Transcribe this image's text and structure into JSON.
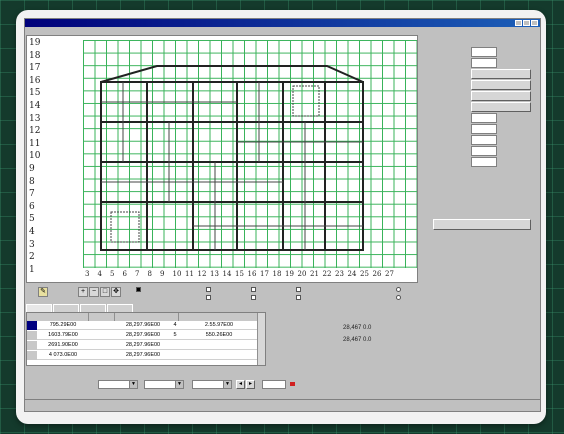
{
  "window": {
    "title": "",
    "menu": [
      "",
      "",
      "",
      "",
      ""
    ]
  },
  "canvas": {
    "row_labels": [
      "19",
      "18",
      "17",
      "16",
      "15",
      "14",
      "13",
      "12",
      "11",
      "10",
      "9",
      "8",
      "7",
      "6",
      "5",
      "4",
      "3",
      "2",
      "1"
    ],
    "col_labels": [
      "3",
      "4",
      "5",
      "6",
      "7",
      "8",
      "9",
      "10",
      "11",
      "12",
      "13",
      "14",
      "15",
      "16",
      "17",
      "18",
      "19",
      "20",
      "21",
      "22",
      "23",
      "24",
      "25",
      "26",
      "27"
    ],
    "grid_color": "#39b35a"
  },
  "info_panel": {
    "header": "",
    "properties": [
      {
        "label": "",
        "value": ""
      },
      {
        "label": "",
        "value": ""
      },
      {
        "label": "",
        "button": ""
      },
      {
        "label": "",
        "button": ""
      },
      {
        "label": "",
        "button": ""
      },
      {
        "label": "",
        "button": ""
      },
      {
        "label": "",
        "value": ""
      },
      {
        "label": "",
        "value": ""
      },
      {
        "label": "",
        "value": ""
      },
      {
        "label": "",
        "value": ""
      },
      {
        "label": "",
        "value": ""
      }
    ],
    "wide_button": "",
    "note_top_right": "",
    "note_left_1": "",
    "note_left_2": ""
  },
  "toolbar": {
    "checks_left": [
      "",
      ""
    ],
    "checks_mid": [
      "",
      "",
      "",
      ""
    ],
    "radios_right": [
      "",
      ""
    ],
    "legend": ""
  },
  "tabs": [
    "",
    "",
    "",
    ""
  ],
  "table": {
    "headers": [
      "",
      "",
      "",
      ""
    ],
    "rows": [
      {
        "index": "",
        "c1": "795.29E00",
        "c2": "",
        "c3": "28,297.96E00",
        "c4": "4",
        "c5": "2.55.97E00"
      },
      {
        "index": "",
        "c1": "1603.79E00",
        "c2": "",
        "c3": "28,297.96E00",
        "c4": "5",
        "c5": "550.26E00"
      },
      {
        "index": "",
        "c1": "2691.90E00",
        "c2": "",
        "c3": "28,297.96E00",
        "c4": "",
        "c5": ""
      },
      {
        "index": "",
        "c1": "4 073.0E00",
        "c2": "",
        "c3": "28,297.96E00",
        "c4": "",
        "c5": ""
      }
    ]
  },
  "readouts": [
    {
      "label": "",
      "value": "28,467 0.0"
    },
    {
      "label": "",
      "value": "28,467 0.0"
    }
  ],
  "bottom": {
    "group_label_1": "",
    "group_label_2": "",
    "combos": [
      "",
      "",
      ""
    ],
    "value_box": "",
    "status_left": "",
    "status_mid": "",
    "status_right": ""
  },
  "statusbar": {
    "text": ""
  }
}
